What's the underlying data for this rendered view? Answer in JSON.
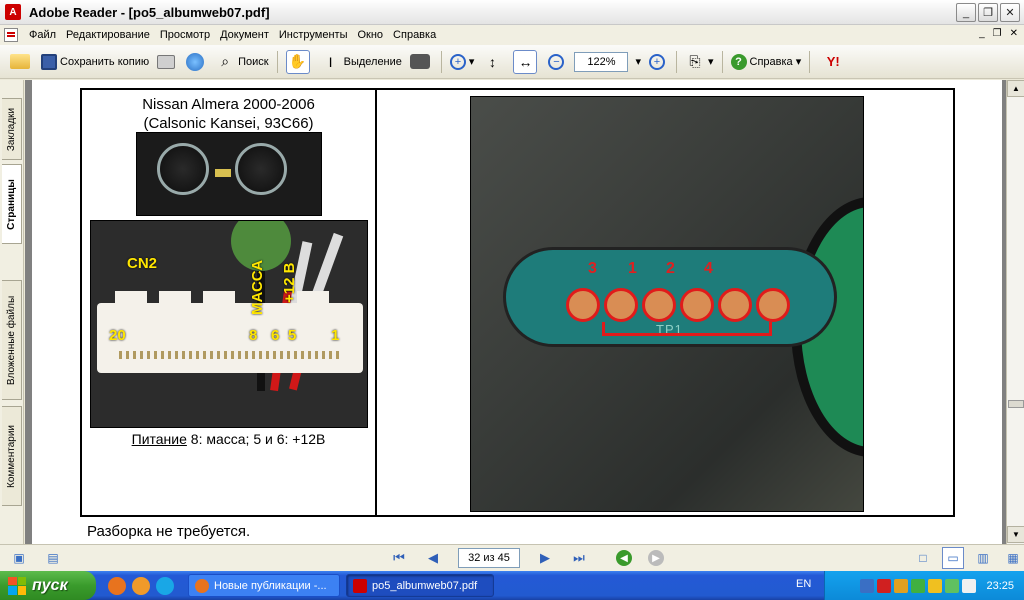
{
  "window": {
    "title": "Adobe Reader - [po5_albumweb07.pdf]",
    "minimize": "_",
    "restore": "❐",
    "close": "✕"
  },
  "menu": {
    "items": [
      "Файл",
      "Редактирование",
      "Просмотр",
      "Документ",
      "Инструменты",
      "Окно",
      "Справка"
    ]
  },
  "toolbar": {
    "save_copy": "Сохранить копию",
    "search": "Поиск",
    "selection": "Выделение",
    "zoom_value": "122%",
    "help": "Справка"
  },
  "side_tabs": [
    "Закладки",
    "Страницы",
    "Вложенные файлы",
    "Комментарии"
  ],
  "document": {
    "car_title_1": "Nissan Almera 2000-2006",
    "car_title_2": "(Calsonic Kansei, 93C66)",
    "connector_labels": {
      "cn2": "CN2",
      "massa": "МАССА",
      "plus12": "+12 В",
      "pin20": "20",
      "pin8": "8",
      "pin6": "6",
      "pin5": "5",
      "pin1": "1"
    },
    "power_caption_label": "Питание",
    "power_caption_text": " 8: масса; 5 и 6: +12В",
    "pcb_pads": [
      "3",
      "1",
      "2",
      "4"
    ],
    "pcb_label": "TP1",
    "bottom_text": "Разборка не требуется."
  },
  "statusbar": {
    "page_indicator": "32 из 45"
  },
  "taskbar": {
    "start": "пуск",
    "tasks": [
      "Новые публикации -...",
      "po5_albumweb07.pdf"
    ],
    "lang": "EN",
    "clock": "23:25"
  }
}
